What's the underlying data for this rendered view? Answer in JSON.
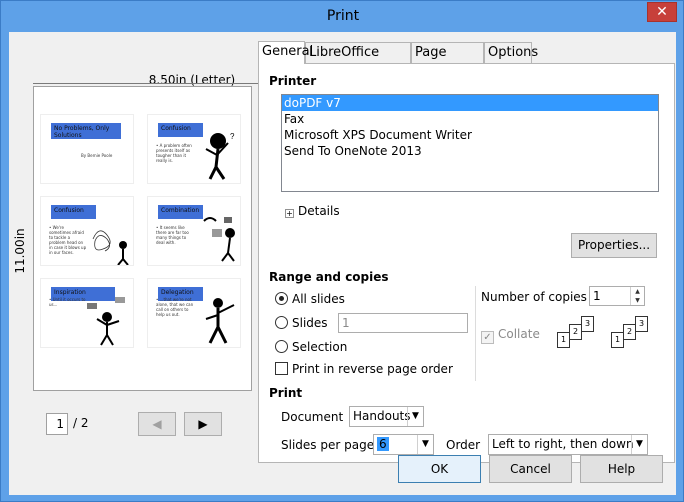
{
  "window": {
    "title": "Print",
    "close_glyph": "✕"
  },
  "preview": {
    "width_label": "8.50in (Letter)",
    "height_label": "11.00in",
    "slides": [
      {
        "title": "No Problems, Only Solutions",
        "body": "By Bernie Poole"
      },
      {
        "title": "Confusion",
        "body": "• A problem often presents itself as tougher than it really is."
      },
      {
        "title": "Confusion",
        "body": "• We're sometimes afraid to tackle a problem head on in case it blows up in our faces."
      },
      {
        "title": "Combination",
        "body": "• It seems like there are far too many things to deal with."
      },
      {
        "title": "Inspiration",
        "body": "• Until it occurs to us..."
      },
      {
        "title": "Delegation",
        "body": "• ...that we're not alone, that we can call on others to help us out."
      }
    ],
    "current_page": "1",
    "total_pages": "/ 2",
    "prev_icon": "◀",
    "next_icon": "▶"
  },
  "tabs": [
    "General",
    "LibreOffice Impress",
    "Page Layout",
    "Options"
  ],
  "printer": {
    "section_title": "Printer",
    "items": [
      "doPDF v7",
      "Fax",
      "Microsoft XPS Document Writer",
      "Send To OneNote 2013"
    ],
    "selected_index": 0,
    "details_label": "Details",
    "properties_label": "Properties..."
  },
  "range": {
    "section_title": "Range and copies",
    "all_slides": "All slides",
    "slides": "Slides",
    "slides_value": "1",
    "selection": "Selection",
    "reverse": "Print in reverse page order",
    "copies_label": "Number of copies",
    "copies_value": "1",
    "collate_label": "Collate"
  },
  "print": {
    "section_title": "Print",
    "document_label": "Document",
    "document_value": "Handouts",
    "slides_per_page_label": "Slides per page",
    "slides_per_page_value": "6",
    "order_label": "Order",
    "order_value": "Left to right, then down"
  },
  "buttons": {
    "ok": "OK",
    "cancel": "Cancel",
    "help": "Help"
  }
}
